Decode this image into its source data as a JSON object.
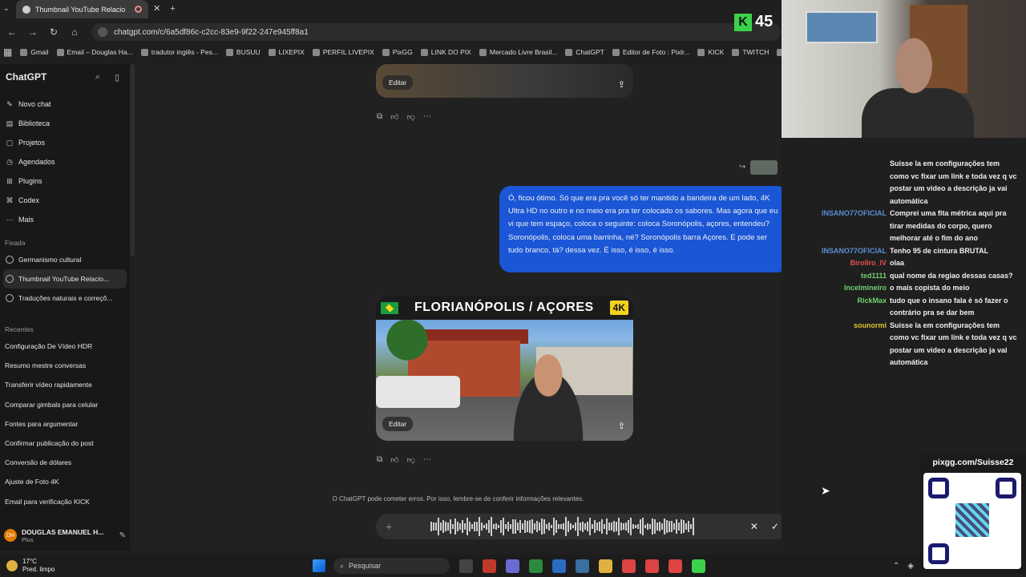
{
  "browser": {
    "tab_title": "Thumbnail YouTube Relacio",
    "url": "chatgpt.com/c/6a5df86c-c2cc-83e9-9f22-247e945ff8a1",
    "bookmarks": [
      "Gmail",
      "Email – Douglas Ha...",
      "tradutor inglês - Pes...",
      "BUSUU",
      "LIXEPIX",
      "PERFIL LIVEPIX",
      "PixGG",
      "LINK DO PIX",
      "Mercado Livre Brasil...",
      "ChatGPT",
      "Editor de Foto : Pixlr...",
      "KICK",
      "TWITCH",
      "botr"
    ]
  },
  "sidebar": {
    "brand": "ChatGPT",
    "menu": [
      "Novo chat",
      "Biblioteca",
      "Projetos",
      "Agendados",
      "Plugins",
      "Codex",
      "Mais"
    ],
    "pinned_label": "Fixada",
    "pinned": [
      "Germanismo cultural",
      "Thumbnail YouTube Relacio...",
      "Traduções naturais e correçõ..."
    ],
    "recent_label": "Recentes",
    "recent": [
      "Configuração De Vídeo HDR",
      "Resumo mestre conversas",
      "Transferir vídeo rapidamente",
      "Comparar gimbals para celular",
      "Fontes para argumentar",
      "Confirmar publicação do post",
      "Conversão de dólares",
      "Ajuste de Foto 4K",
      "Email para verificação KICK"
    ],
    "user_initials": "DH",
    "user_name": "DOUGLAS EMANUEL H...",
    "user_plan": "Plus"
  },
  "conversation": {
    "edit_label": "Editar",
    "user_message": "Ó, ficou ótimo. Só que era pra você só ter mantido a bandeira de um lado, 4K Ultra HD no outro e no meio era pra ter colocado os sabores. Mas agora que eu vi que tem espaço, coloca o seguinte: coloca Soronópolis, açores, entendeu? Soronópolis, coloca uma barrinha, né? Soronópolis barra Açores. E pode ser tudo branco, tá? dessa vez. É isso, é isso, é isso.",
    "thumbnail_title": "FLORIANÓPOLIS / AÇORES",
    "thumbnail_badge": "4K",
    "disclaimer": "O ChatGPT pode cometer erros. Por isso, lembre-se de conferir informações relevantes."
  },
  "overlay": {
    "k_label": "K",
    "k_count": "45",
    "qr_title": "pixgg.com/Suisse22"
  },
  "chat": [
    {
      "user": "",
      "color": "#5b8fd6",
      "text": "Suisse la em configurações tem como vc fixar um link e toda vez q vc postar um video a descrição ja vai automática"
    },
    {
      "user": "INSANO77OFICIAL",
      "color": "#5b8fd6",
      "text": "Comprei uma fita métrica aqui pra tirar medidas do corpo, quero melhorar até o fim do ano"
    },
    {
      "user": "INSANO77OFICIAL",
      "color": "#5b8fd6",
      "text": "Tenho 95 de cintura BRUTAL"
    },
    {
      "user": "Birollro_IV",
      "color": "#e05050",
      "text": "olaa"
    },
    {
      "user": "ted1111",
      "color": "#6fd16f",
      "text": "qual nome da regiao dessas casas?"
    },
    {
      "user": "Incelmineiro",
      "color": "#6fd16f",
      "text": "o mais copista do meio"
    },
    {
      "user": "RickMax",
      "color": "#6fd16f",
      "text": "tudo que o insano fala é só fazer o contrário pra se dar bem"
    },
    {
      "user": "sounormi",
      "color": "#e0c030",
      "text": "Suisse la em configurações tem como vc fixar um link e toda vez q vc postar um video a descrição ja vai automática"
    }
  ],
  "taskbar": {
    "temp": "17°C",
    "weather": "Pred. limpo",
    "search_placeholder": "Pesquisar"
  }
}
